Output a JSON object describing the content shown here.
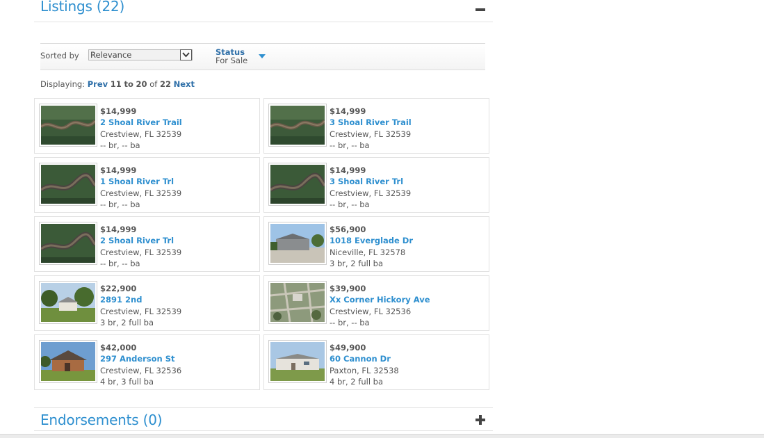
{
  "listings_section": {
    "title": "Listings (22)",
    "toggle_icon": "minus-icon"
  },
  "sort": {
    "label": "Sorted by",
    "selected": "Relevance",
    "status_label": "Status",
    "status_value": "For Sale"
  },
  "pagination": {
    "prefix": "Displaying:",
    "prev": "Prev",
    "from": "11",
    "to_word": "to",
    "to": "20",
    "of_word": "of",
    "total": "22",
    "next": "Next"
  },
  "listings": [
    {
      "price": "$14,999",
      "address": "2 Shoal River Trail",
      "city": "Crestview, FL 32539",
      "beds_baths": "-- br, -- ba",
      "photo": "aerial-river"
    },
    {
      "price": "$14,999",
      "address": "3 Shoal River Trail",
      "city": "Crestview, FL 32539",
      "beds_baths": "-- br, -- ba",
      "photo": "aerial-river"
    },
    {
      "price": "$14,999",
      "address": "1 Shoal River Trl",
      "city": "Crestview, FL 32539",
      "beds_baths": "-- br, -- ba",
      "photo": "aerial-river-wide"
    },
    {
      "price": "$14,999",
      "address": "3 Shoal River Trl",
      "city": "Crestview, FL 32539",
      "beds_baths": "-- br, -- ba",
      "photo": "aerial-river-wide"
    },
    {
      "price": "$14,999",
      "address": "2 Shoal River Trl",
      "city": "Crestview, FL 32539",
      "beds_baths": "-- br, -- ba",
      "photo": "aerial-river-wide"
    },
    {
      "price": "$56,900",
      "address": "1018 Everglade Dr",
      "city": "Niceville, FL 32578",
      "beds_baths": "3 br, 2 full ba",
      "photo": "house-sky"
    },
    {
      "price": "$22,900",
      "address": "2891 2nd",
      "city": "Crestview, FL 32539",
      "beds_baths": "3 br, 2 full ba",
      "photo": "house-trees"
    },
    {
      "price": "$39,900",
      "address": "Xx Corner Hickory Ave",
      "city": "Crestview, FL 32536",
      "beds_baths": "-- br, -- ba",
      "photo": "aerial-lots"
    },
    {
      "price": "$42,000",
      "address": "297 Anderson St",
      "city": "Crestview, FL 32536",
      "beds_baths": "4 br, 3 full ba",
      "photo": "house-brick"
    },
    {
      "price": "$49,900",
      "address": "60 Cannon Dr",
      "city": "Paxton, FL 32538",
      "beds_baths": "4 br, 2 full ba",
      "photo": "house-mobile"
    }
  ],
  "endorsements_section": {
    "title": "Endorsements (0)",
    "toggle_icon": "plus-icon"
  }
}
